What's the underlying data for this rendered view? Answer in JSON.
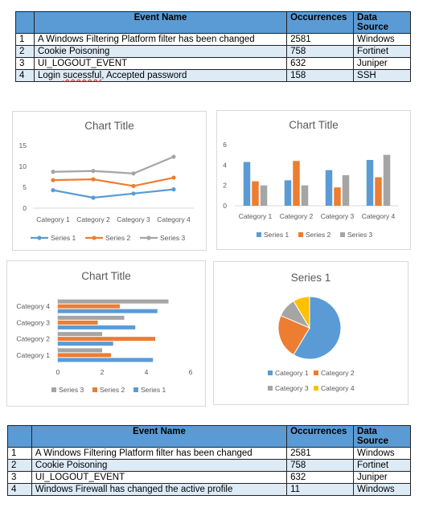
{
  "table_top": {
    "headers": [
      "",
      "Event Name",
      "Occurrences",
      "Data Source"
    ],
    "rows": [
      [
        "1",
        "A Windows Filtering Platform filter has been changed",
        "2581",
        "Windows"
      ],
      [
        "2",
        "Cookie Poisoning",
        "758",
        "Fortinet"
      ],
      [
        "3",
        "UI_LOGOUT_EVENT",
        "632",
        "Juniper"
      ],
      [
        "4",
        "Login sucessful, Accepted password",
        "158",
        "SSH"
      ]
    ]
  },
  "table_bottom": {
    "headers": [
      "",
      "Event Name",
      "Occurrences",
      "Data Source"
    ],
    "rows": [
      [
        "1",
        "A Windows Filtering Platform filter has been changed",
        "2581",
        "Windows"
      ],
      [
        "2",
        "Cookie Poisoning",
        "758",
        "Fortinet"
      ],
      [
        "3",
        "UI_LOGOUT_EVENT",
        "632",
        "Juniper"
      ],
      [
        "4",
        "Windows Firewall has changed the active profile",
        "11",
        "Windows"
      ]
    ]
  },
  "colors": {
    "series1": "#5b9bd5",
    "series2": "#ed7d31",
    "series3": "#a5a5a5",
    "series4": "#ffc000",
    "header": "#5b9bd5",
    "alt_row": "#ddebf7"
  },
  "chart_data": [
    {
      "type": "line",
      "title": "Chart Title",
      "categories": [
        "Category 1",
        "Category 2",
        "Category 3",
        "Category 4"
      ],
      "series": [
        {
          "name": "Series 1",
          "values": [
            4.3,
            2.5,
            3.5,
            4.5
          ]
        },
        {
          "name": "Series 2",
          "values": [
            2.4,
            4.4,
            1.8,
            2.8
          ]
        },
        {
          "name": "Series 3",
          "values": [
            2,
            2,
            3,
            5
          ]
        }
      ],
      "stacked": true,
      "yticks": [
        "0",
        "5",
        "10",
        "15"
      ],
      "ylim": [
        0,
        15
      ],
      "legend": "bottom",
      "grid": false
    },
    {
      "type": "bar",
      "title": "Chart Title",
      "categories": [
        "Category 1",
        "Category 2",
        "Category 3",
        "Category 4"
      ],
      "series": [
        {
          "name": "Series 1",
          "values": [
            4.3,
            2.5,
            3.5,
            4.5
          ]
        },
        {
          "name": "Series 2",
          "values": [
            2.4,
            4.4,
            1.8,
            2.8
          ]
        },
        {
          "name": "Series 3",
          "values": [
            2,
            2,
            3,
            5
          ]
        }
      ],
      "yticks": [
        "0",
        "2",
        "4",
        "6"
      ],
      "ylim": [
        0,
        6
      ],
      "legend": "bottom",
      "grid": false
    },
    {
      "type": "bar",
      "orientation": "horizontal",
      "title": "Chart Title",
      "categories": [
        "Category 1",
        "Category 2",
        "Category 3",
        "Category 4"
      ],
      "series": [
        {
          "name": "Series 1",
          "values": [
            4.3,
            2.5,
            3.5,
            4.5
          ]
        },
        {
          "name": "Series 2",
          "values": [
            2.4,
            4.4,
            1.8,
            2.8
          ]
        },
        {
          "name": "Series 3",
          "values": [
            2,
            2,
            3,
            5
          ]
        }
      ],
      "xticks": [
        "0",
        "2",
        "4",
        "6"
      ],
      "xlim": [
        0,
        6
      ],
      "legend": "bottom",
      "legend_order": [
        "Series 3",
        "Series 2",
        "Series 1"
      ],
      "grid": false
    },
    {
      "type": "pie",
      "title": "Series 1",
      "categories": [
        "Category 1",
        "Category 2",
        "Category 3",
        "Category 4"
      ],
      "values": [
        8.2,
        3.2,
        1.4,
        1.2
      ],
      "legend": "bottom"
    }
  ]
}
